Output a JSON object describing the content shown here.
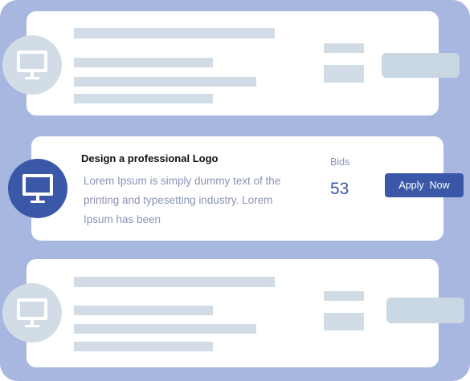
{
  "job": {
    "title": "Design a professional Logo",
    "description": "Lorem Ipsum is simply dummy text of the printing and typesetting industry. Lorem Ipsum has been",
    "bids_label": "Bids",
    "bids_count": "53",
    "apply_label": "Apply  Now"
  },
  "icons": {
    "job_icon": "monitor-icon"
  },
  "colors": {
    "background": "#a7b7df",
    "accent": "#3a58a7",
    "placeholder": "#d1dce6",
    "muted_text": "#8b93b6"
  }
}
